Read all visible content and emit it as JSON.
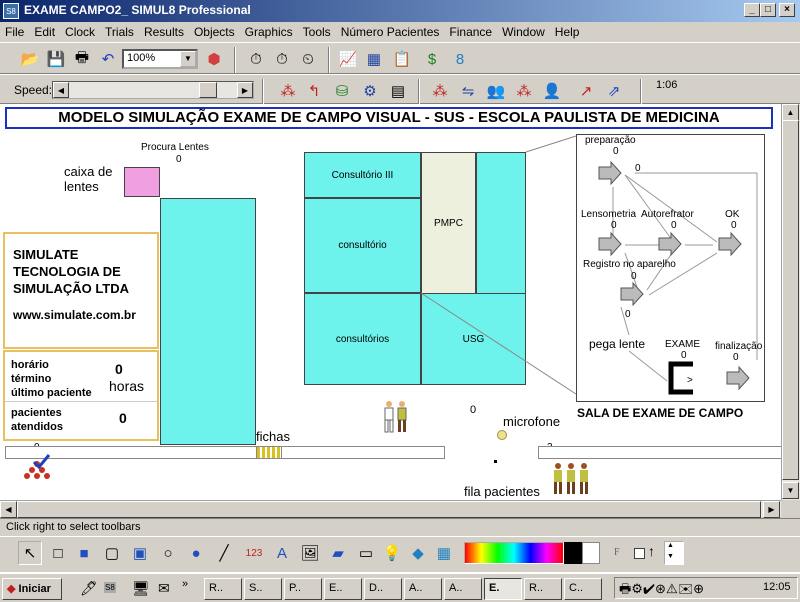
{
  "window": {
    "title": "EXAME CAMPO2_   SIMUL8 Professional",
    "app_icon": "S8"
  },
  "menu": [
    "File",
    "Edit",
    "Clock",
    "Trials",
    "Results",
    "Objects",
    "Graphics",
    "Tools",
    "Número Pacientes",
    "Finance",
    "Window",
    "Help"
  ],
  "toolbar": {
    "zoom": "100%",
    "speed_label": "Speed:",
    "clock": "1:06"
  },
  "model": {
    "banner": "MODELO SIMULAÇÃO EXAME DE CAMPO VISUAL - SUS - ESCOLA PAULISTA DE MEDICINA",
    "procura_lentes": {
      "label": "Procura Lentes",
      "count": "0"
    },
    "caixa_lentes": "caixa de\nlentes",
    "company": {
      "line1": "SIMULATE",
      "line2": "TECNOLOGIA DE",
      "line3": "SIMULAÇÃO LTDA",
      "url": "www.simulate.com.br"
    },
    "stats": {
      "horario_label1": "horário",
      "horario_label2": "término",
      "horario_label3": "último paciente",
      "horario_value": "0",
      "horas": "horas",
      "pacientes_label1": "pacientes",
      "pacientes_label2": "atendidos",
      "pacientes_value": "0"
    },
    "rooms": {
      "consultorio3": "Consultório III",
      "consultorio": "consultório",
      "consultorios": "consultórios",
      "pmpc": "PMPC",
      "usg": "USG"
    },
    "exam_room": {
      "title": "SALA DE EXAME DE CAMPO",
      "preparacao": "preparação",
      "preparacao_count": "0",
      "preparacao_queue": "0",
      "lensometria": "Lensometria",
      "lensometria_count": "0",
      "autorefrator": "Autorefrator",
      "autorefrator_count": "0",
      "ok": "OK",
      "ok_count": "0",
      "registro": "Registro no aparelho",
      "registro_count": "0",
      "pega_lente": "pega lente",
      "pega_lente_count": "0",
      "exame": "EXAME",
      "exame_count": "0",
      "finalizacao": "finalização",
      "finalizacao_count": "0"
    },
    "fichas": "fichas",
    "microfone": "microfone",
    "microfone_count": "0",
    "fila_pacientes": "fila pacientes",
    "queue_left_count": "0",
    "queue_right_count": "3"
  },
  "status": "Click right to select toolbars",
  "taskbar": {
    "start": "Iniciar",
    "tasks": [
      "R..",
      "S..",
      "P..",
      "E..",
      "D..",
      "A..",
      "A..",
      "E.",
      "R..",
      "C.."
    ],
    "time": "12:05"
  }
}
